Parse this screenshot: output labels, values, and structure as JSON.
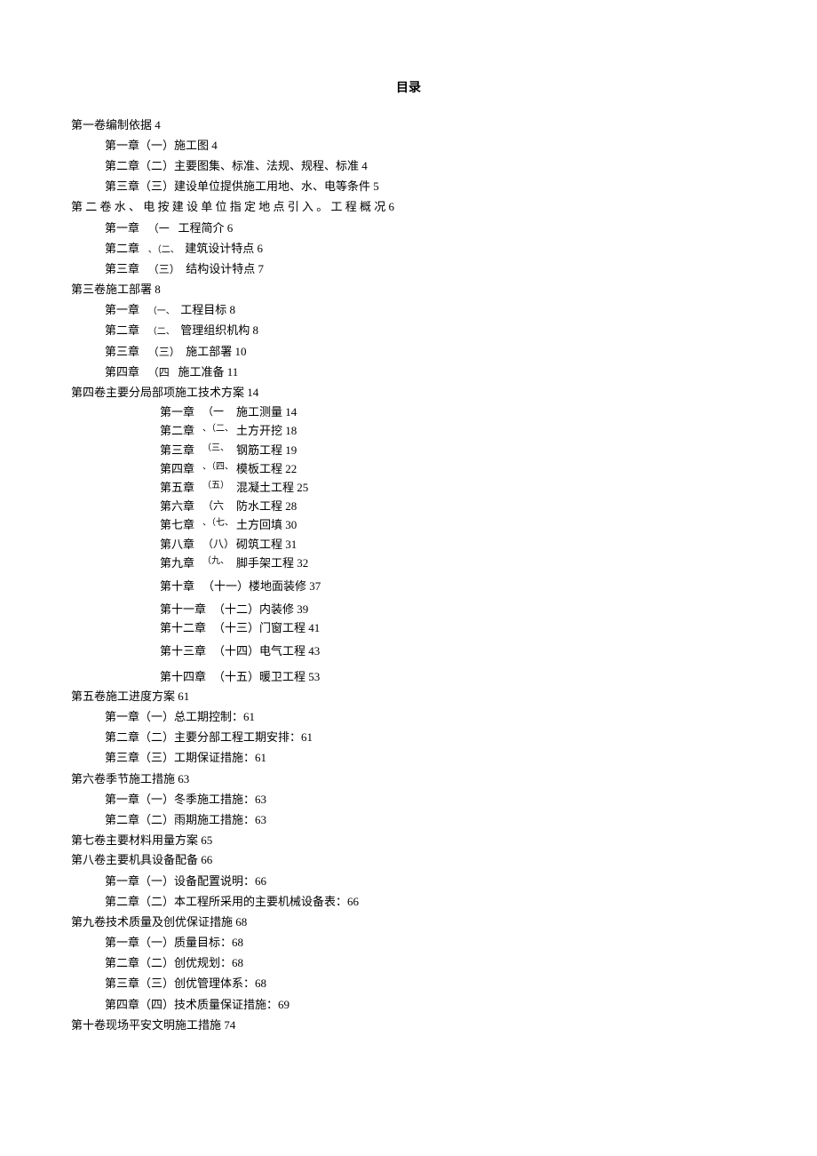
{
  "title": "目录",
  "entries": {
    "v1": "第一卷编制依据 4",
    "v1c1": "第一章（一）施工图 4",
    "v1c2": "第二章（二）主要图集、标准、法规、规程、标准 4",
    "v1c3": "第三章（三）建设单位提供施工用地、水、电等条件 5",
    "v2": "第 二 卷 水 、 电 按 建 设 单 位 指 定 地 点 引 入 。 工 程 概 况 6",
    "v2c1_a": "第一章",
    "v2c1_b": "（一",
    "v2c1_c": "工程简介 6",
    "v2c2_a": "第二章",
    "v2c2_b": "、（二、",
    "v2c2_c": "建筑设计特点 6",
    "v2c3_a": "第三章",
    "v2c3_b": "（三）",
    "v2c3_c": "结构设计特点 7",
    "v3": "第三卷施工部署 8",
    "v3c1_a": "第一章",
    "v3c1_b": "（一、",
    "v3c1_c": "工程目标 8",
    "v3c2_a": "第二章",
    "v3c2_b": "（二、",
    "v3c2_c": "管理组织机构 8",
    "v3c3_a": "第三章",
    "v3c3_b": "（三）",
    "v3c3_c": "施工部署 10",
    "v3c4_a": "第四章",
    "v3c4_b": "（四",
    "v3c4_c": "施工准备 11",
    "v4": "第四卷主要分局部项施工技术方案 14",
    "v4c1_a": "第一章",
    "v4c1_b": "（一",
    "v4c1_c": "施工测量 14",
    "v4c2_a": "第二章",
    "v4c2_b": "、（二、",
    "v4c2_c": "土方开挖 18",
    "v4c3_a": "第三章",
    "v4c3_b": "（三、",
    "v4c3_c": "钢筋工程 19",
    "v4c4_a": "第四章",
    "v4c4_b": "、（四、",
    "v4c4_c": "模板工程 22",
    "v4c5_a": "第五章",
    "v4c5_b": "（五）",
    "v4c5_c": "混凝土工程 25",
    "v4c6_a": "第六章",
    "v4c6_b": "（六",
    "v4c6_c": "防水工程 28",
    "v4c7_a": "第七章",
    "v4c7_b": "、（七、",
    "v4c7_c": "土方回填 30",
    "v4c8_a": "第八章",
    "v4c8_b": "（八）",
    "v4c8_c": "砌筑工程 31",
    "v4c9_a": "第九章",
    "v4c9_b": "（九、",
    "v4c9_c": "脚手架工程 32",
    "v4c10_a": "第十章",
    "v4c10_b": "（十一）",
    "v4c10_c": "楼地面装修 37",
    "v4c11_a": "第十一章",
    "v4c11_b": "（十二）",
    "v4c11_c": "内装修 39",
    "v4c12_a": "第十二章",
    "v4c12_b": "（十三）",
    "v4c12_c": "门窗工程 41",
    "v4c13_a": "第十三章",
    "v4c13_b": "（十四）",
    "v4c13_c": "电气工程 43",
    "v4c14_a": "第十四章",
    "v4c14_b": "（十五）",
    "v4c14_c": "暖卫工程 53",
    "v5": "第五卷施工进度方案 61",
    "v5c1": "第一章（一）总工期控制：61",
    "v5c2": "第二章（二）主要分部工程工期安排：61",
    "v5c3": "第三章（三）工期保证措施：61",
    "v6": "第六卷季节施工措施 63",
    "v6c1": "第一章（一）冬季施工措施：63",
    "v6c2": "第二章（二）雨期施工措施：63",
    "v7": "第七卷主要材料用量方案 65",
    "v8": "第八卷主要机具设备配备 66",
    "v8c1": "第一章（一）设备配置说明：66",
    "v8c2": "第二章（二）本工程所采用的主要机械设备表：66",
    "v9": "第九卷技术质量及创优保证措施 68",
    "v9c1": "第一章（一）质量目标：68",
    "v9c2": "第二章（二）创优规划：68",
    "v9c3": "第三章（三）创优管理体系：68",
    "v9c4": "第四章（四）技术质量保证措施：69",
    "v10": "第十卷现场平安文明施工措施 74"
  }
}
